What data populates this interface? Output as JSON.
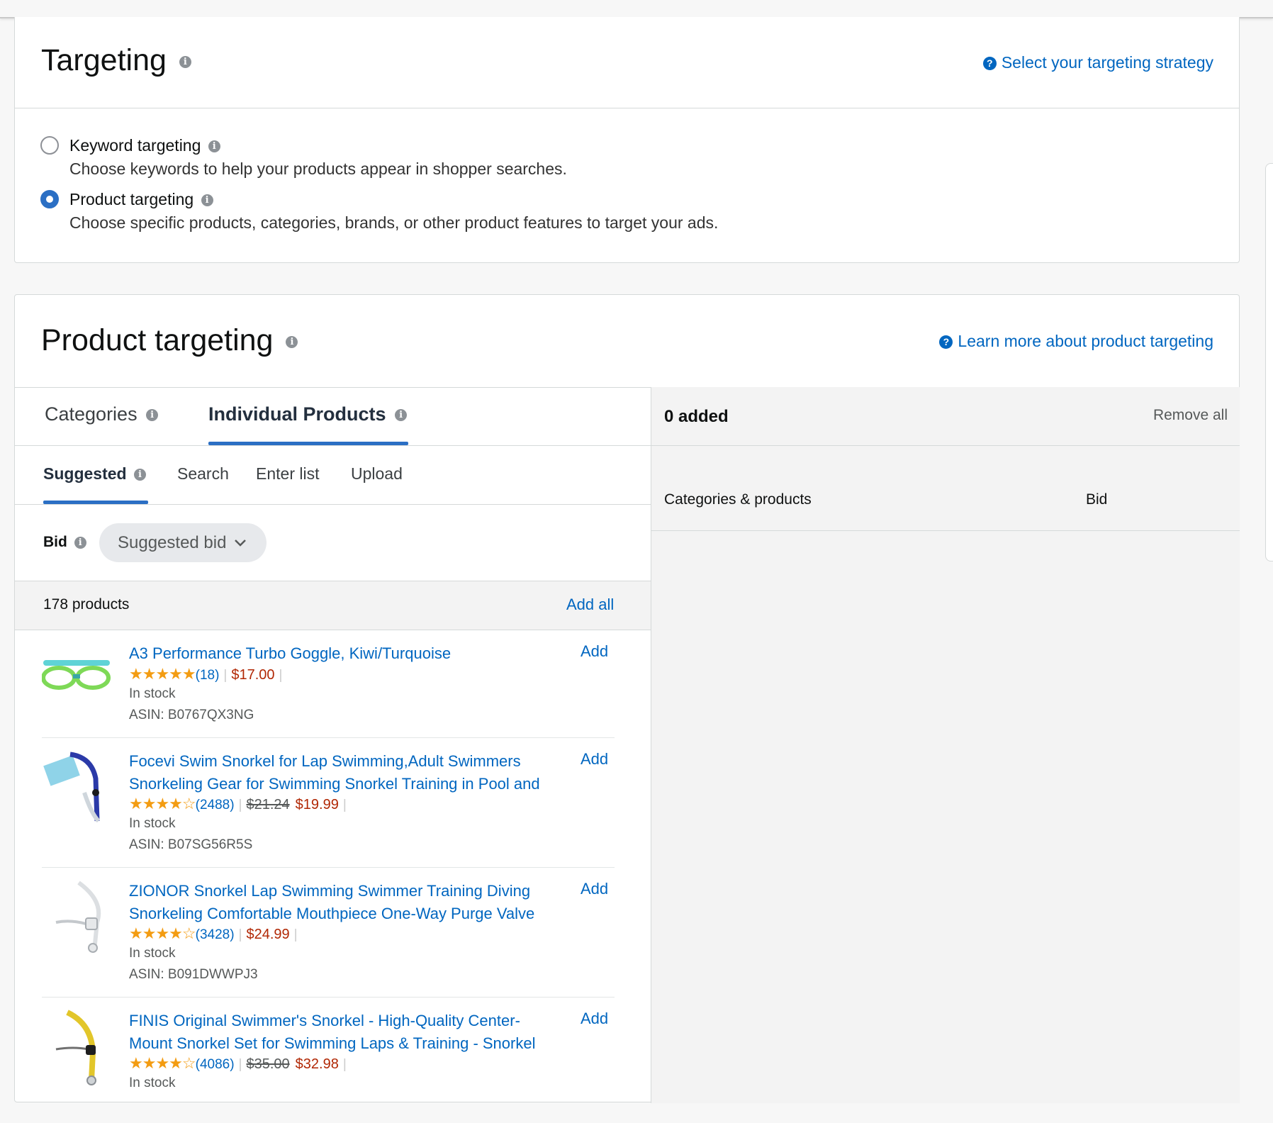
{
  "targeting": {
    "title": "Targeting",
    "help_link": "Select your targeting strategy",
    "options": [
      {
        "label": "Keyword targeting",
        "desc": "Choose keywords to help your products appear in shopper searches.",
        "selected": false
      },
      {
        "label": "Product targeting",
        "desc": "Choose specific products, categories, brands, or other product features to target your ads.",
        "selected": true
      }
    ]
  },
  "product_targeting": {
    "title": "Product targeting",
    "help_link": "Learn more about product targeting",
    "tabs": [
      {
        "label": "Categories",
        "active": false
      },
      {
        "label": "Individual Products",
        "active": true
      }
    ],
    "subtabs": [
      {
        "label": "Suggested",
        "active": true
      },
      {
        "label": "Search",
        "active": false
      },
      {
        "label": "Enter list",
        "active": false
      },
      {
        "label": "Upload",
        "active": false
      }
    ],
    "bid_label": "Bid",
    "bid_select": "Suggested bid",
    "count_label": "178 products",
    "add_all": "Add all",
    "add_label": "Add",
    "products": [
      {
        "title": "A3 Performance Turbo Goggle, Kiwi/Turquoise",
        "stars": "★★★★★",
        "count": "(18)",
        "old_price": "",
        "price": "$17.00",
        "stock": "In stock",
        "asin": "ASIN: B0767QX3NG"
      },
      {
        "title": "Focevi Swim Snorkel for Lap Swimming,Adult Swimmers Snorkeling Gear for Swimming Snorkel Training in Pool and",
        "stars": "★★★★☆",
        "count": "(2488)",
        "old_price": "$21.24",
        "price": "$19.99",
        "stock": "In stock",
        "asin": "ASIN: B07SG56R5S"
      },
      {
        "title": "ZIONOR Snorkel Lap Swimming Swimmer Training Diving Snorkeling Comfortable Mouthpiece One-Way Purge Valve",
        "stars": "★★★★☆",
        "count": "(3428)",
        "old_price": "",
        "price": "$24.99",
        "stock": "In stock",
        "asin": "ASIN: B091DWWPJ3"
      },
      {
        "title": "FINIS Original Swimmer's Snorkel - High-Quality Center-Mount Snorkel Set for Swimming Laps & Training - Snorkel",
        "stars": "★★★★☆",
        "count": "(4086)",
        "old_price": "$35.00",
        "price": "$32.98",
        "stock": "In stock",
        "asin": ""
      }
    ],
    "added": {
      "count_label": "0 added",
      "remove_all": "Remove all",
      "col_categories": "Categories & products",
      "col_bid": "Bid"
    }
  },
  "colors": {
    "link": "#0066c0",
    "accent": "#2b6fc4",
    "price": "#b12704",
    "star": "#f39c12"
  }
}
